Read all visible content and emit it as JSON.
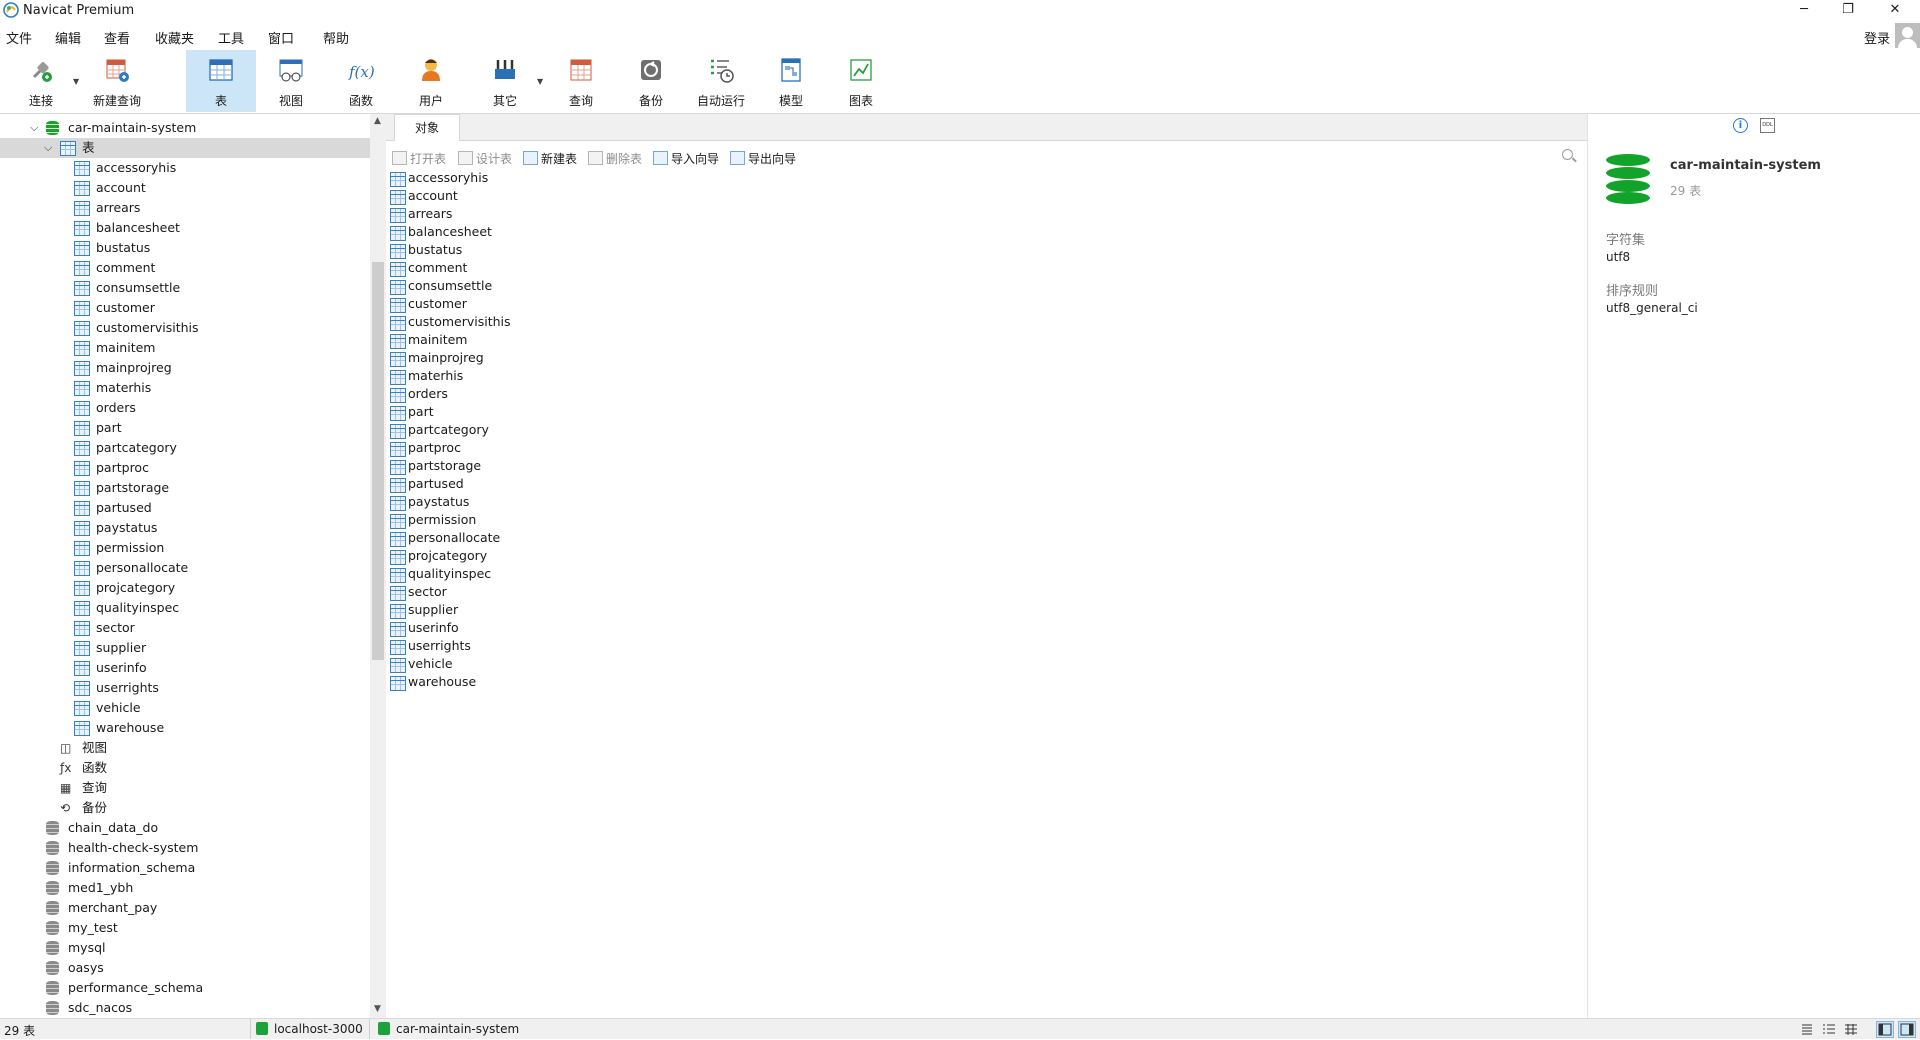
{
  "window": {
    "title": "Navicat Premium",
    "controls": [
      "─",
      "❐",
      "✕"
    ]
  },
  "menu": [
    "文件",
    "编辑",
    "查看",
    "收藏夹",
    "工具",
    "窗口",
    "帮助"
  ],
  "account": {
    "login": "登录"
  },
  "toolbar": [
    {
      "label": "连接",
      "icon": "connection-icon"
    },
    {
      "label": "新建查询",
      "icon": "new-query-icon"
    },
    {
      "label": "表",
      "icon": "table-icon",
      "active": true
    },
    {
      "label": "视图",
      "icon": "view-icon"
    },
    {
      "label": "函数",
      "icon": "function-icon",
      "glyph": "f(x)"
    },
    {
      "label": "用户",
      "icon": "user-icon"
    },
    {
      "label": "其它",
      "icon": "tools-icon"
    },
    {
      "label": "查询",
      "icon": "query-icon"
    },
    {
      "label": "备份",
      "icon": "backup-icon"
    },
    {
      "label": "自动运行",
      "icon": "schedule-icon"
    },
    {
      "label": "模型",
      "icon": "model-icon"
    },
    {
      "label": "图表",
      "icon": "chart-icon"
    }
  ],
  "tree": {
    "active_db": "car-maintain-system",
    "tables_node": "表",
    "tables": [
      "accessoryhis",
      "account",
      "arrears",
      "balancesheet",
      "bustatus",
      "comment",
      "consumsettle",
      "customer",
      "customervisithis",
      "mainitem",
      "mainprojreg",
      "materhis",
      "orders",
      "part",
      "partcategory",
      "partproc",
      "partstorage",
      "partused",
      "paystatus",
      "permission",
      "personallocate",
      "projcategory",
      "qualityinspec",
      "sector",
      "supplier",
      "userinfo",
      "userrights",
      "vehicle",
      "warehouse"
    ],
    "other_nodes": [
      {
        "label": "视图",
        "icon": "view-icon",
        "glyph": "◫"
      },
      {
        "label": "函数",
        "icon": "function-icon",
        "glyph": "ƒx"
      },
      {
        "label": "查询",
        "icon": "query-icon",
        "glyph": "▦"
      },
      {
        "label": "备份",
        "icon": "backup-icon",
        "glyph": "⟲"
      }
    ],
    "databases": [
      "chain_data_do",
      "health-check-system",
      "information_schema",
      "med1_ybh",
      "merchant_pay",
      "my_test",
      "mysql",
      "oasys",
      "performance_schema",
      "sdc_nacos"
    ]
  },
  "objects": {
    "tab": "对象",
    "actions": [
      {
        "label": "打开表",
        "disabled": true
      },
      {
        "label": "设计表",
        "disabled": true
      },
      {
        "label": "新建表",
        "disabled": false
      },
      {
        "label": "删除表",
        "disabled": true
      },
      {
        "label": "导入向导",
        "disabled": false
      },
      {
        "label": "导出向导",
        "disabled": false
      }
    ]
  },
  "info": {
    "name": "car-maintain-system",
    "count": "29 表",
    "charset_label": "字符集",
    "charset_value": "utf8",
    "collation_label": "排序规则",
    "collation_value": "utf8_general_ci",
    "ddl_icon_text": "DDL"
  },
  "status": {
    "count": "29 表",
    "connection": "localhost-3000",
    "database": "car-maintain-system"
  },
  "colors": {
    "accent": "#cde6f7",
    "db_green": "#14a32a",
    "table_blue": "#3a7fc2"
  }
}
